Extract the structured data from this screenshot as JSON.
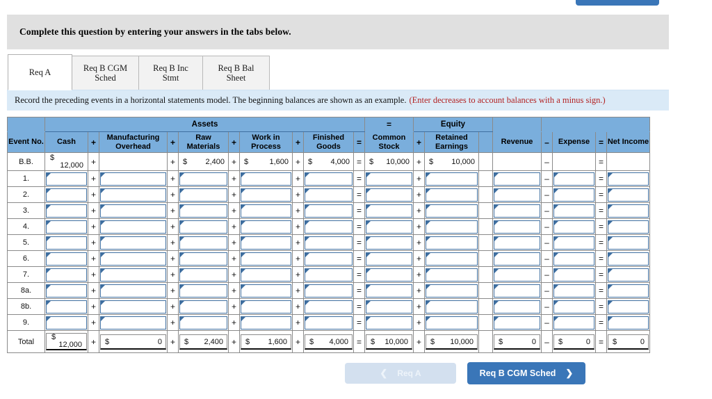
{
  "top_button": {
    "label": ""
  },
  "prompt": {
    "text": "Complete this question by entering your answers in the tabs below."
  },
  "tabs": [
    {
      "label": "Req A",
      "active": true
    },
    {
      "label": "Req B CGM Sched",
      "active": false
    },
    {
      "label": "Req B Inc Stmt",
      "active": false
    },
    {
      "label": "Req B Bal Sheet",
      "active": false
    }
  ],
  "requirement": {
    "text": "Record the preceding events in a horizontal statements model. The beginning balances are shown as an example.",
    "note": "(Enter decreases to account balances with a minus sign.)"
  },
  "table": {
    "group_headers": {
      "assets": "Assets",
      "equals": "=",
      "equity": "Equity"
    },
    "columns": {
      "event_no": "Event No.",
      "cash": "Cash",
      "manufacturing_overhead": "Manufacturing Overhead",
      "raw_materials": "Raw Materials",
      "work_in_process": "Work in Process",
      "finished_goods": "Finished Goods",
      "common_stock": "Common Stock",
      "retained_earnings": "Retained Earnings",
      "revenue": "Revenue",
      "expense": "Expense",
      "net_income": "Net Income"
    },
    "operators": {
      "plus": "+",
      "equals": "=",
      "minus": "–"
    },
    "rows": [
      {
        "event": "B.B.",
        "type": "balance",
        "cash": {
          "cur": "$",
          "num": "12,000",
          "wrap": true
        },
        "manufacturing_overhead": {
          "cur": "",
          "num": ""
        },
        "raw_materials": {
          "cur": "$",
          "num": "2,400"
        },
        "work_in_process": {
          "cur": "$",
          "num": "1,600"
        },
        "finished_goods": {
          "cur": "$",
          "num": "4,000"
        },
        "common_stock": {
          "cur": "$",
          "num": "10,000"
        },
        "retained_earnings": {
          "cur": "$",
          "num": "10,000"
        },
        "revenue": {
          "cur": "",
          "num": ""
        },
        "expense": {
          "cur": "",
          "num": ""
        },
        "net_income": {
          "cur": "",
          "num": ""
        }
      },
      {
        "event": "1.",
        "type": "input"
      },
      {
        "event": "2.",
        "type": "input"
      },
      {
        "event": "3.",
        "type": "input"
      },
      {
        "event": "4.",
        "type": "input"
      },
      {
        "event": "5.",
        "type": "input"
      },
      {
        "event": "6.",
        "type": "input"
      },
      {
        "event": "7.",
        "type": "input"
      },
      {
        "event": "8a.",
        "type": "input"
      },
      {
        "event": "8b.",
        "type": "input"
      },
      {
        "event": "9.",
        "type": "input"
      },
      {
        "event": "Total",
        "type": "total",
        "cash": {
          "cur": "$",
          "num": "12,000",
          "wrap": true
        },
        "manufacturing_overhead": {
          "cur": "$",
          "num": "0"
        },
        "raw_materials": {
          "cur": "$",
          "num": "2,400"
        },
        "work_in_process": {
          "cur": "$",
          "num": "1,600"
        },
        "finished_goods": {
          "cur": "$",
          "num": "4,000"
        },
        "common_stock": {
          "cur": "$",
          "num": "10,000"
        },
        "retained_earnings": {
          "cur": "$",
          "num": "10,000"
        },
        "revenue": {
          "cur": "$",
          "num": "0"
        },
        "expense": {
          "cur": "$",
          "num": "0"
        },
        "net_income": {
          "cur": "$",
          "num": "0"
        }
      }
    ]
  },
  "nav": {
    "prev_label": "Req A",
    "prev_icon": "chevron-left-icon",
    "next_label": "Req B CGM Sched",
    "next_icon": "chevron-right-icon"
  },
  "colors": {
    "header_blue": "#7aaedc",
    "accent_blue": "#3a76b8",
    "banner_grey": "#e0e0e0",
    "banner_blue": "#daeaf7",
    "note_red": "#b32222",
    "input_border": "#3f6fa0"
  }
}
